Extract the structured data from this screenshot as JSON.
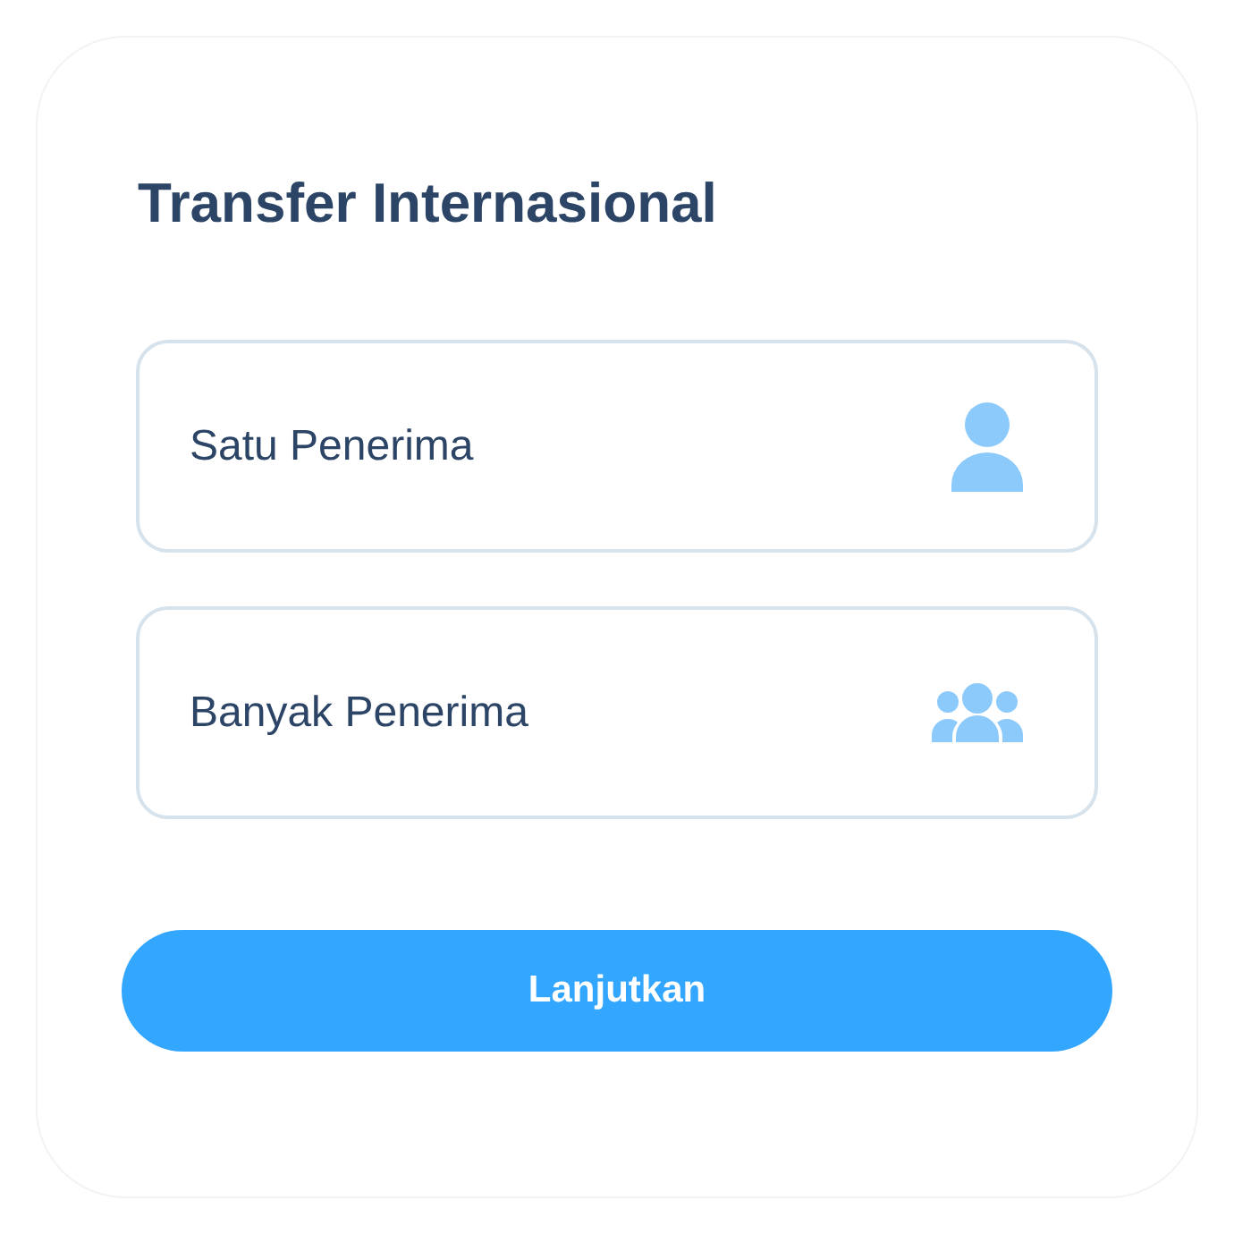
{
  "title": "Transfer Internasional",
  "options": [
    {
      "label": "Satu Penerima",
      "kind": "single",
      "selected": false
    },
    {
      "label": "Banyak Penerima",
      "kind": "multiple",
      "selected": false
    }
  ],
  "button": {
    "label": "Lanjutkan"
  }
}
